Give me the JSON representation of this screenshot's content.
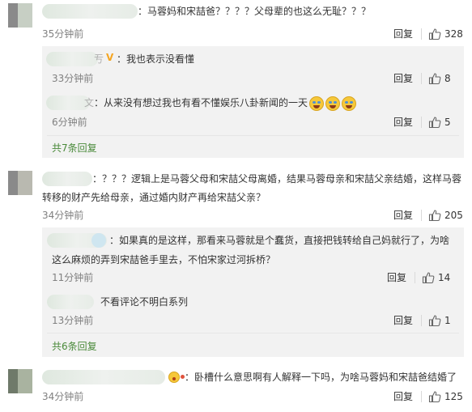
{
  "reply_label": "回复",
  "comments": [
    {
      "text_line1": "：马蓉妈和宋喆爸？？？？父母辈的也这么无耻？？？",
      "time": "35分钟前",
      "likes": "328",
      "replies": [
        {
          "text": "：我也表示没看懂",
          "time": "33分钟前",
          "likes": "8"
        },
        {
          "text": "：从来没有想过我也有看不懂娱乐八卦新闻的一天",
          "time": "6分钟前",
          "likes": "5"
        }
      ],
      "more": "共7条回复"
    },
    {
      "text_line1": "：？？？逻辑上是马蓉父母和宋喆父母离婚，结果马蓉母亲和宋喆父亲结婚，这样马蓉",
      "text_line2": "转移的财产先给母亲，通过婚内财产再给宋喆父亲？",
      "time": "34分钟前",
      "likes": "205",
      "replies": [
        {
          "text_line1": "：如果真的是这样，那看来马蓉就是个蠢货，直接把钱转给自己妈就行了，为啥",
          "text_line2": "这么麻烦的弄到宋喆爸手里去，不怕宋家过河拆桥？",
          "time": "11分钟前",
          "likes": "14"
        },
        {
          "text": "不看评论不明白系列",
          "time": "13分钟前",
          "likes": "1"
        }
      ],
      "more": "共6条回复"
    },
    {
      "text_line1": "：卧槽什么意思啊有人解释一下吗，为啥马蓉妈和宋喆爸结婚了",
      "time": "34分钟前",
      "likes": "125"
    }
  ],
  "icons": {
    "like": "thumbs-up-icon",
    "verified": "verified-v-icon",
    "emoji": "laugh-cry-emoji-icon"
  },
  "colors": {
    "more_link": "#4a8a3a",
    "panel_bg": "#f2f2f2"
  }
}
